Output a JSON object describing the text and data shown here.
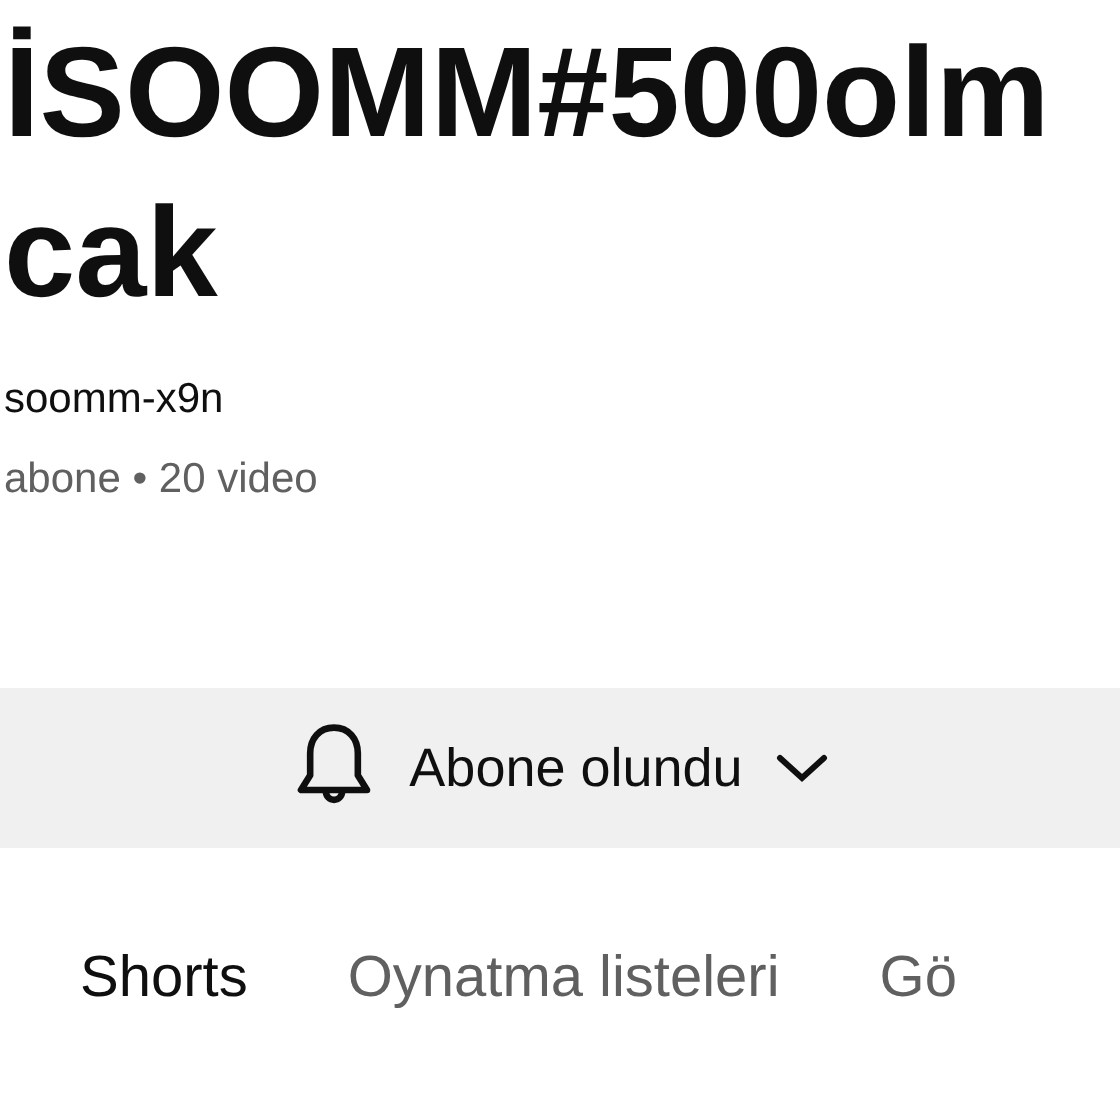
{
  "channel": {
    "title_lines": [
      "İSOOMM#500olm",
      "cak"
    ],
    "handle": "soomm-x9n",
    "stats": "abone • 20 video"
  },
  "subscribe_button": {
    "label": "Abone olundu"
  },
  "tabs": [
    {
      "label": "Shorts",
      "selected": true
    },
    {
      "label": "Oynatma listeleri",
      "selected": false
    },
    {
      "label": "Gö",
      "selected": false
    }
  ]
}
